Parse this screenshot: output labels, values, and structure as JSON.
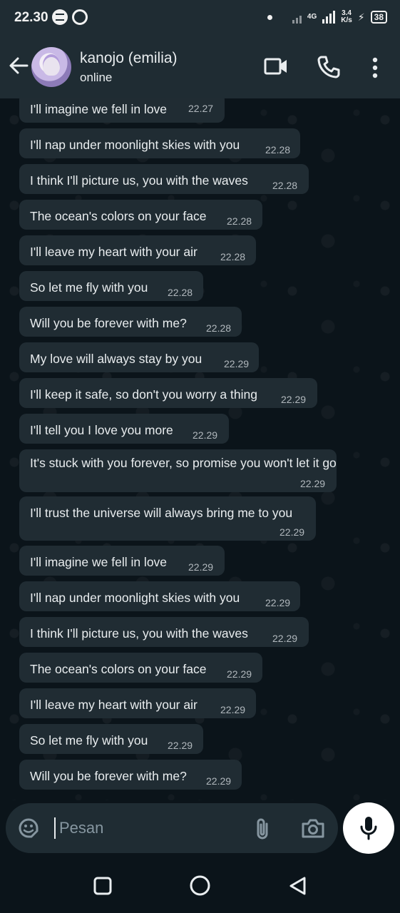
{
  "status_bar": {
    "time": "22.30",
    "network": "4G",
    "speed_value": "3.4",
    "speed_unit": "K/s",
    "battery": "38",
    "icons": [
      "spotify-icon",
      "vpn-ring-icon",
      "dot-icon",
      "signal-icon",
      "charging-bolt-icon",
      "battery-icon"
    ]
  },
  "header": {
    "contact_name": "kanojo (emilia)",
    "status": "online",
    "icons": [
      "back-arrow-icon",
      "avatar",
      "video-call-icon",
      "voice-call-icon",
      "more-options-icon"
    ]
  },
  "messages": [
    {
      "text": "I'll imagine we fell in love",
      "time": "22.27"
    },
    {
      "text": "I'll nap under moonlight skies with you",
      "time": "22.28"
    },
    {
      "text": "I think I'll picture us, you with the waves",
      "time": "22.28"
    },
    {
      "text": "The ocean's colors on your face",
      "time": "22.28"
    },
    {
      "text": "I'll leave my heart with your air",
      "time": "22.28"
    },
    {
      "text": "So let me fly with you",
      "time": "22.28"
    },
    {
      "text": "Will you be forever with me?",
      "time": "22.28"
    },
    {
      "text": "My love will always stay by you",
      "time": "22.29"
    },
    {
      "text": "I'll keep it safe, so don't you worry a thing",
      "time": "22.29"
    },
    {
      "text": "I'll tell you I love you more",
      "time": "22.29"
    },
    {
      "text": "It's stuck with you forever, so promise you won't let it go",
      "time": "22.29"
    },
    {
      "text": "I'll trust the universe will always bring me to you",
      "time": "22.29"
    },
    {
      "text": "I'll imagine we fell in love",
      "time": "22.29"
    },
    {
      "text": "I'll nap under moonlight skies with you",
      "time": "22.29"
    },
    {
      "text": "I think I'll picture us, you with the waves",
      "time": "22.29"
    },
    {
      "text": "The ocean's colors on your face",
      "time": "22.29"
    },
    {
      "text": "I'll leave my heart with your air",
      "time": "22.29"
    },
    {
      "text": "So let me fly with you",
      "time": "22.29"
    },
    {
      "text": "Will you be forever with me?",
      "time": "22.29"
    }
  ],
  "composer": {
    "placeholder": "Pesan",
    "icons": [
      "sticker-icon",
      "attach-icon",
      "camera-icon",
      "mic-icon"
    ]
  },
  "nav_bar": {
    "icons": [
      "recents-icon",
      "home-icon",
      "back-icon"
    ]
  },
  "colors": {
    "background": "#0b141a",
    "bar": "#1f2c33",
    "bubble": "#202c33",
    "text": "#e9edef",
    "time_text": "#b1b8bd"
  }
}
